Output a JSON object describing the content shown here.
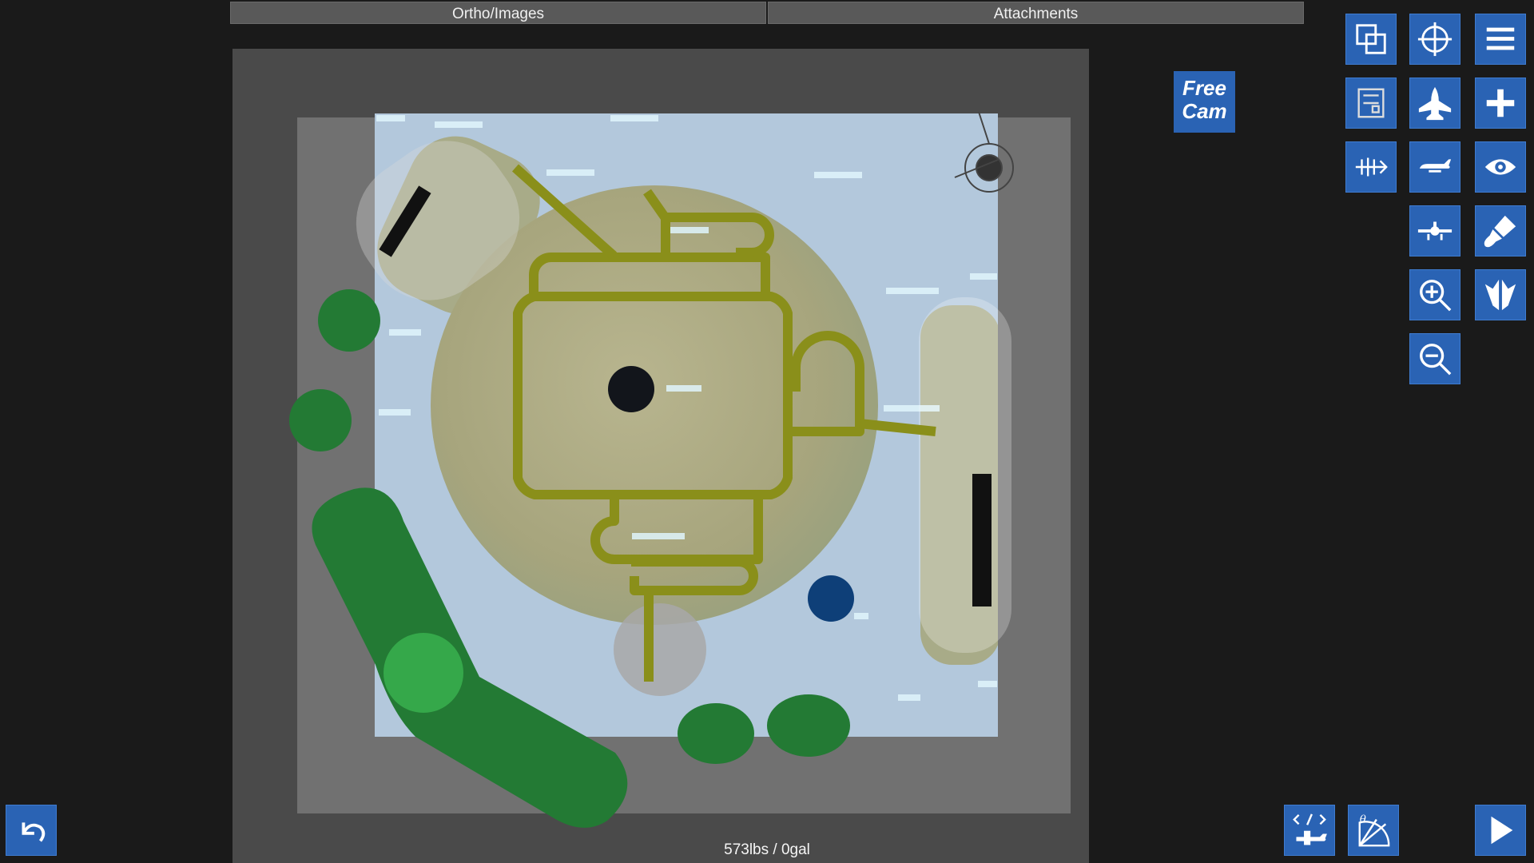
{
  "tabs": [
    {
      "label": "Ortho/Images"
    },
    {
      "label": "Attachments"
    }
  ],
  "free_cam": {
    "line1": "Free",
    "line2": "Cam"
  },
  "status": {
    "weight": "573lbs / 0gal"
  },
  "colors": {
    "panel_blue": "#2a63b4",
    "taxiway_olive": "#8a8f1a",
    "zone_green": "#237a34",
    "zone_green_light": "#35a84a",
    "marker_navy": "#0e3f78",
    "marker_dark": "#12151b",
    "strip_black": "#111111"
  },
  "toolbar_icons": [
    "overlap-squares-icon",
    "crosshair-icon",
    "menu-icon",
    "blueprint-icon",
    "jet-top-icon",
    "plus-icon",
    "fishbone-icon",
    "plane-side-icon",
    "eye-icon",
    "plane-front-icon",
    "paint-brush-icon",
    "zoom-in-icon",
    "wing-symmetry-icon",
    "zoom-out-icon"
  ],
  "bottom_icons": [
    "undo-icon",
    "code-plane-icon",
    "angle-gauge-icon",
    "play-icon"
  ]
}
